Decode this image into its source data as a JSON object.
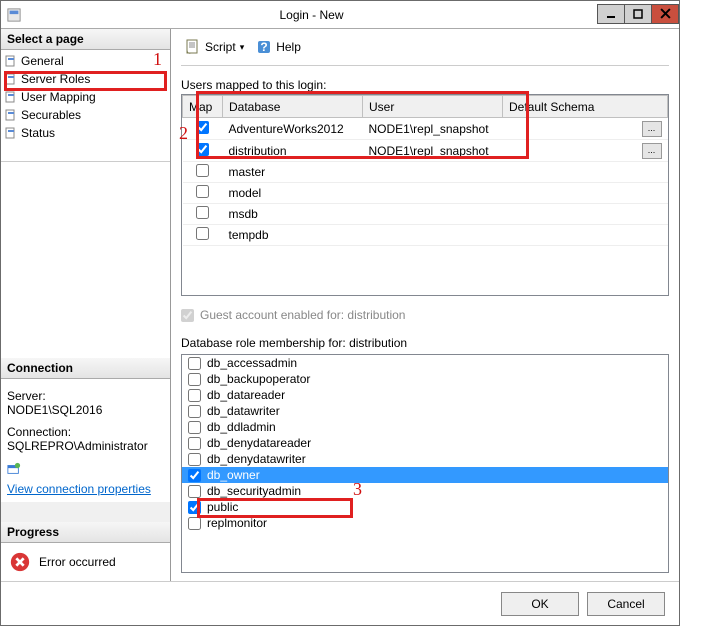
{
  "window": {
    "title": "Login - New"
  },
  "sidebar": {
    "select_page_header": "Select a page",
    "pages": [
      "General",
      "Server Roles",
      "User Mapping",
      "Securables",
      "Status"
    ],
    "connection_header": "Connection",
    "server_label": "Server:",
    "server_value": "NODE1\\SQL2016",
    "connection_label": "Connection:",
    "connection_value": "SQLREPRO\\Administrator",
    "view_conn_props": "View connection properties",
    "progress_header": "Progress",
    "progress_status": "Error occurred"
  },
  "toolbar": {
    "script": "Script",
    "help": "Help"
  },
  "upper": {
    "label": "Users mapped to this login:",
    "columns": {
      "map": "Map",
      "database": "Database",
      "user": "User",
      "default_schema": "Default Schema"
    },
    "rows": [
      {
        "map": true,
        "database": "AdventureWorks2012",
        "user": "NODE1\\repl_snapshot",
        "schema_btn": true
      },
      {
        "map": true,
        "database": "distribution",
        "user": "NODE1\\repl_snapshot",
        "schema_btn": true
      },
      {
        "map": false,
        "database": "master",
        "user": "",
        "schema_btn": false
      },
      {
        "map": false,
        "database": "model",
        "user": "",
        "schema_btn": false
      },
      {
        "map": false,
        "database": "msdb",
        "user": "",
        "schema_btn": false
      },
      {
        "map": false,
        "database": "tempdb",
        "user": "",
        "schema_btn": false
      }
    ]
  },
  "guest": {
    "label": "Guest account enabled for: distribution",
    "checked": true
  },
  "roles": {
    "label": "Database role membership for: distribution",
    "items": [
      {
        "name": "db_accessadmin",
        "checked": false,
        "selected": false
      },
      {
        "name": "db_backupoperator",
        "checked": false,
        "selected": false
      },
      {
        "name": "db_datareader",
        "checked": false,
        "selected": false
      },
      {
        "name": "db_datawriter",
        "checked": false,
        "selected": false
      },
      {
        "name": "db_ddladmin",
        "checked": false,
        "selected": false
      },
      {
        "name": "db_denydatareader",
        "checked": false,
        "selected": false
      },
      {
        "name": "db_denydatawriter",
        "checked": false,
        "selected": false
      },
      {
        "name": "db_owner",
        "checked": true,
        "selected": true
      },
      {
        "name": "db_securityadmin",
        "checked": false,
        "selected": false
      },
      {
        "name": "public",
        "checked": true,
        "selected": false
      },
      {
        "name": "replmonitor",
        "checked": false,
        "selected": false
      }
    ]
  },
  "footer": {
    "ok": "OK",
    "cancel": "Cancel"
  },
  "annotations": {
    "one": "1",
    "two": "2",
    "three": "3"
  }
}
